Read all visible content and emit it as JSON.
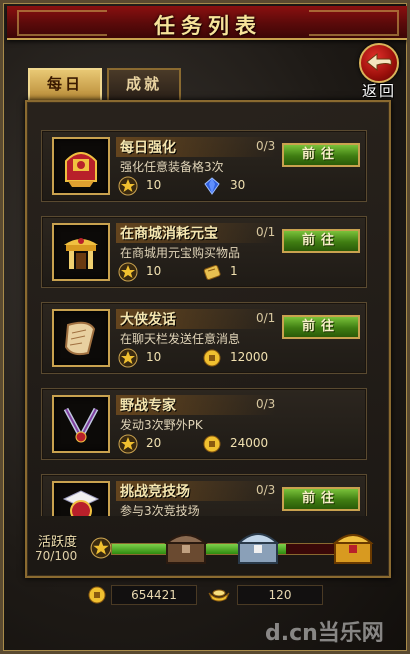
{
  "header": {
    "title": "任务列表"
  },
  "back_button": {
    "label": "返回"
  },
  "tabs": [
    {
      "label": "每日",
      "active": true
    },
    {
      "label": "成就",
      "active": false
    }
  ],
  "quests": [
    {
      "title": "每日强化",
      "progress": "0/3",
      "description": "强化任意装备格3次",
      "rewards": [
        {
          "icon": "star-icon",
          "value": "10"
        },
        {
          "icon": "sapphire-icon",
          "value": "30"
        }
      ],
      "button": "前往",
      "icon": "armor-helmet-icon"
    },
    {
      "title": "在商城消耗元宝",
      "progress": "0/1",
      "description": "在商城用元宝购买物品",
      "rewards": [
        {
          "icon": "star-icon",
          "value": "10"
        },
        {
          "icon": "scroll-ticket-icon",
          "value": "1"
        }
      ],
      "button": "前往",
      "icon": "shop-gate-icon"
    },
    {
      "title": "大侠发话",
      "progress": "0/1",
      "description": "在聊天栏发送任意消息",
      "rewards": [
        {
          "icon": "star-icon",
          "value": "10"
        },
        {
          "icon": "gold-coin-icon",
          "value": "12000"
        }
      ],
      "button": "前往",
      "icon": "scroll-icon"
    },
    {
      "title": "野战专家",
      "progress": "0/3",
      "description": "发动3次野外PK",
      "rewards": [
        {
          "icon": "star-icon",
          "value": "20"
        },
        {
          "icon": "gold-coin-icon",
          "value": "24000"
        }
      ],
      "button": "",
      "icon": "crossed-swords-icon"
    },
    {
      "title": "挑战竞技场",
      "progress": "0/3",
      "description": "参与3次竞技场",
      "rewards": [],
      "button": "前往",
      "icon": "arena-badge-icon"
    }
  ],
  "activity": {
    "label": "活跃度",
    "count": "70/100",
    "current": 70,
    "max": 100
  },
  "currency": {
    "gold": "654421",
    "ingot": "120"
  },
  "watermark": "d.cn当乐网",
  "colors": {
    "title_red": "#8a1010",
    "gold_border": "#c9a24f",
    "button_green": "#3f7d12"
  }
}
